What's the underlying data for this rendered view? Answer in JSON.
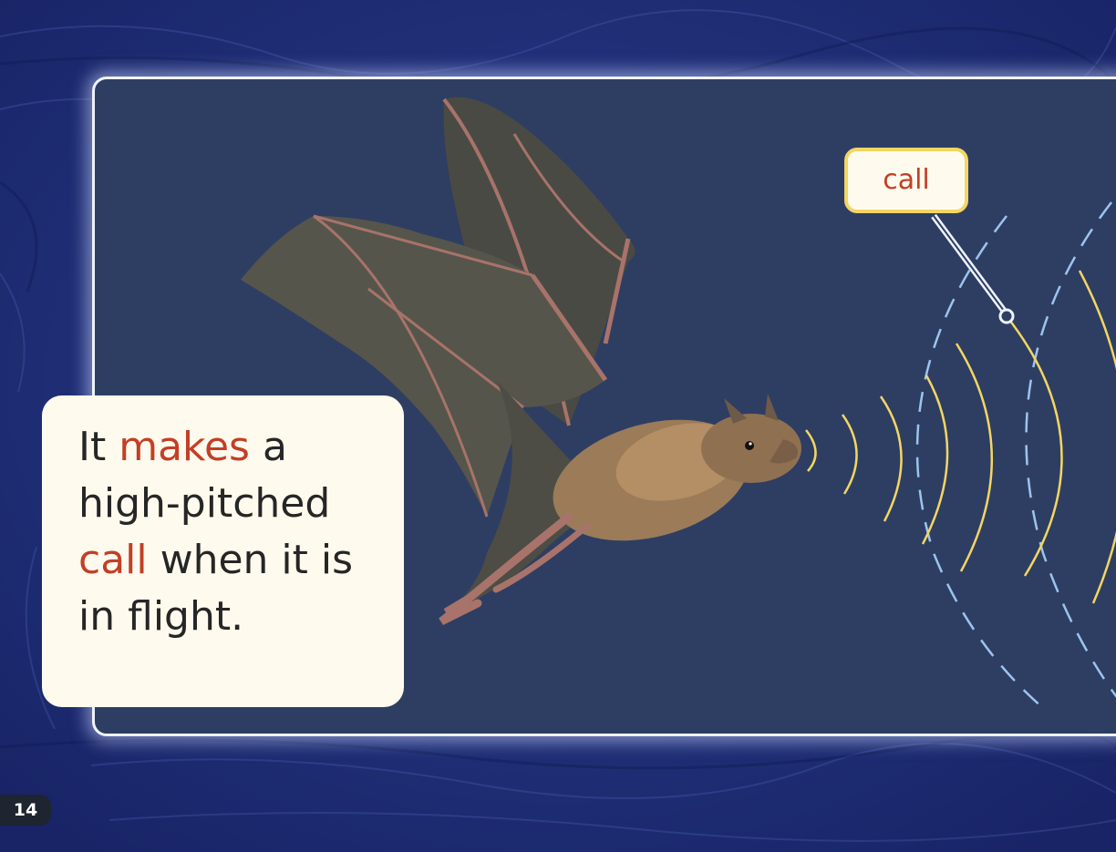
{
  "page": {
    "number": "14"
  },
  "text_box": {
    "segments": [
      {
        "text": "It ",
        "highlight": false
      },
      {
        "text": "makes",
        "highlight": true
      },
      {
        "text": " a",
        "highlight": false
      },
      {
        "text": "high-pitched",
        "highlight": false,
        "break_before": true
      },
      {
        "text": "call",
        "highlight": true,
        "break_before": true
      },
      {
        "text": " when it is",
        "highlight": false
      },
      {
        "text": "in flight.",
        "highlight": false,
        "break_before": true
      }
    ]
  },
  "callout": {
    "label": "call"
  },
  "colors": {
    "background": "#1f2f78",
    "panel": "#2e3e63",
    "text_box": "#fefbee",
    "highlight_text": "#c23f26",
    "sound_waves": "#f3d663",
    "echo_waves": "#9cc4ee"
  },
  "illustration": {
    "subject": "bat-in-flight",
    "icons": [
      "bat-illustration",
      "sound-wave-icon",
      "echo-wave-icon"
    ]
  }
}
